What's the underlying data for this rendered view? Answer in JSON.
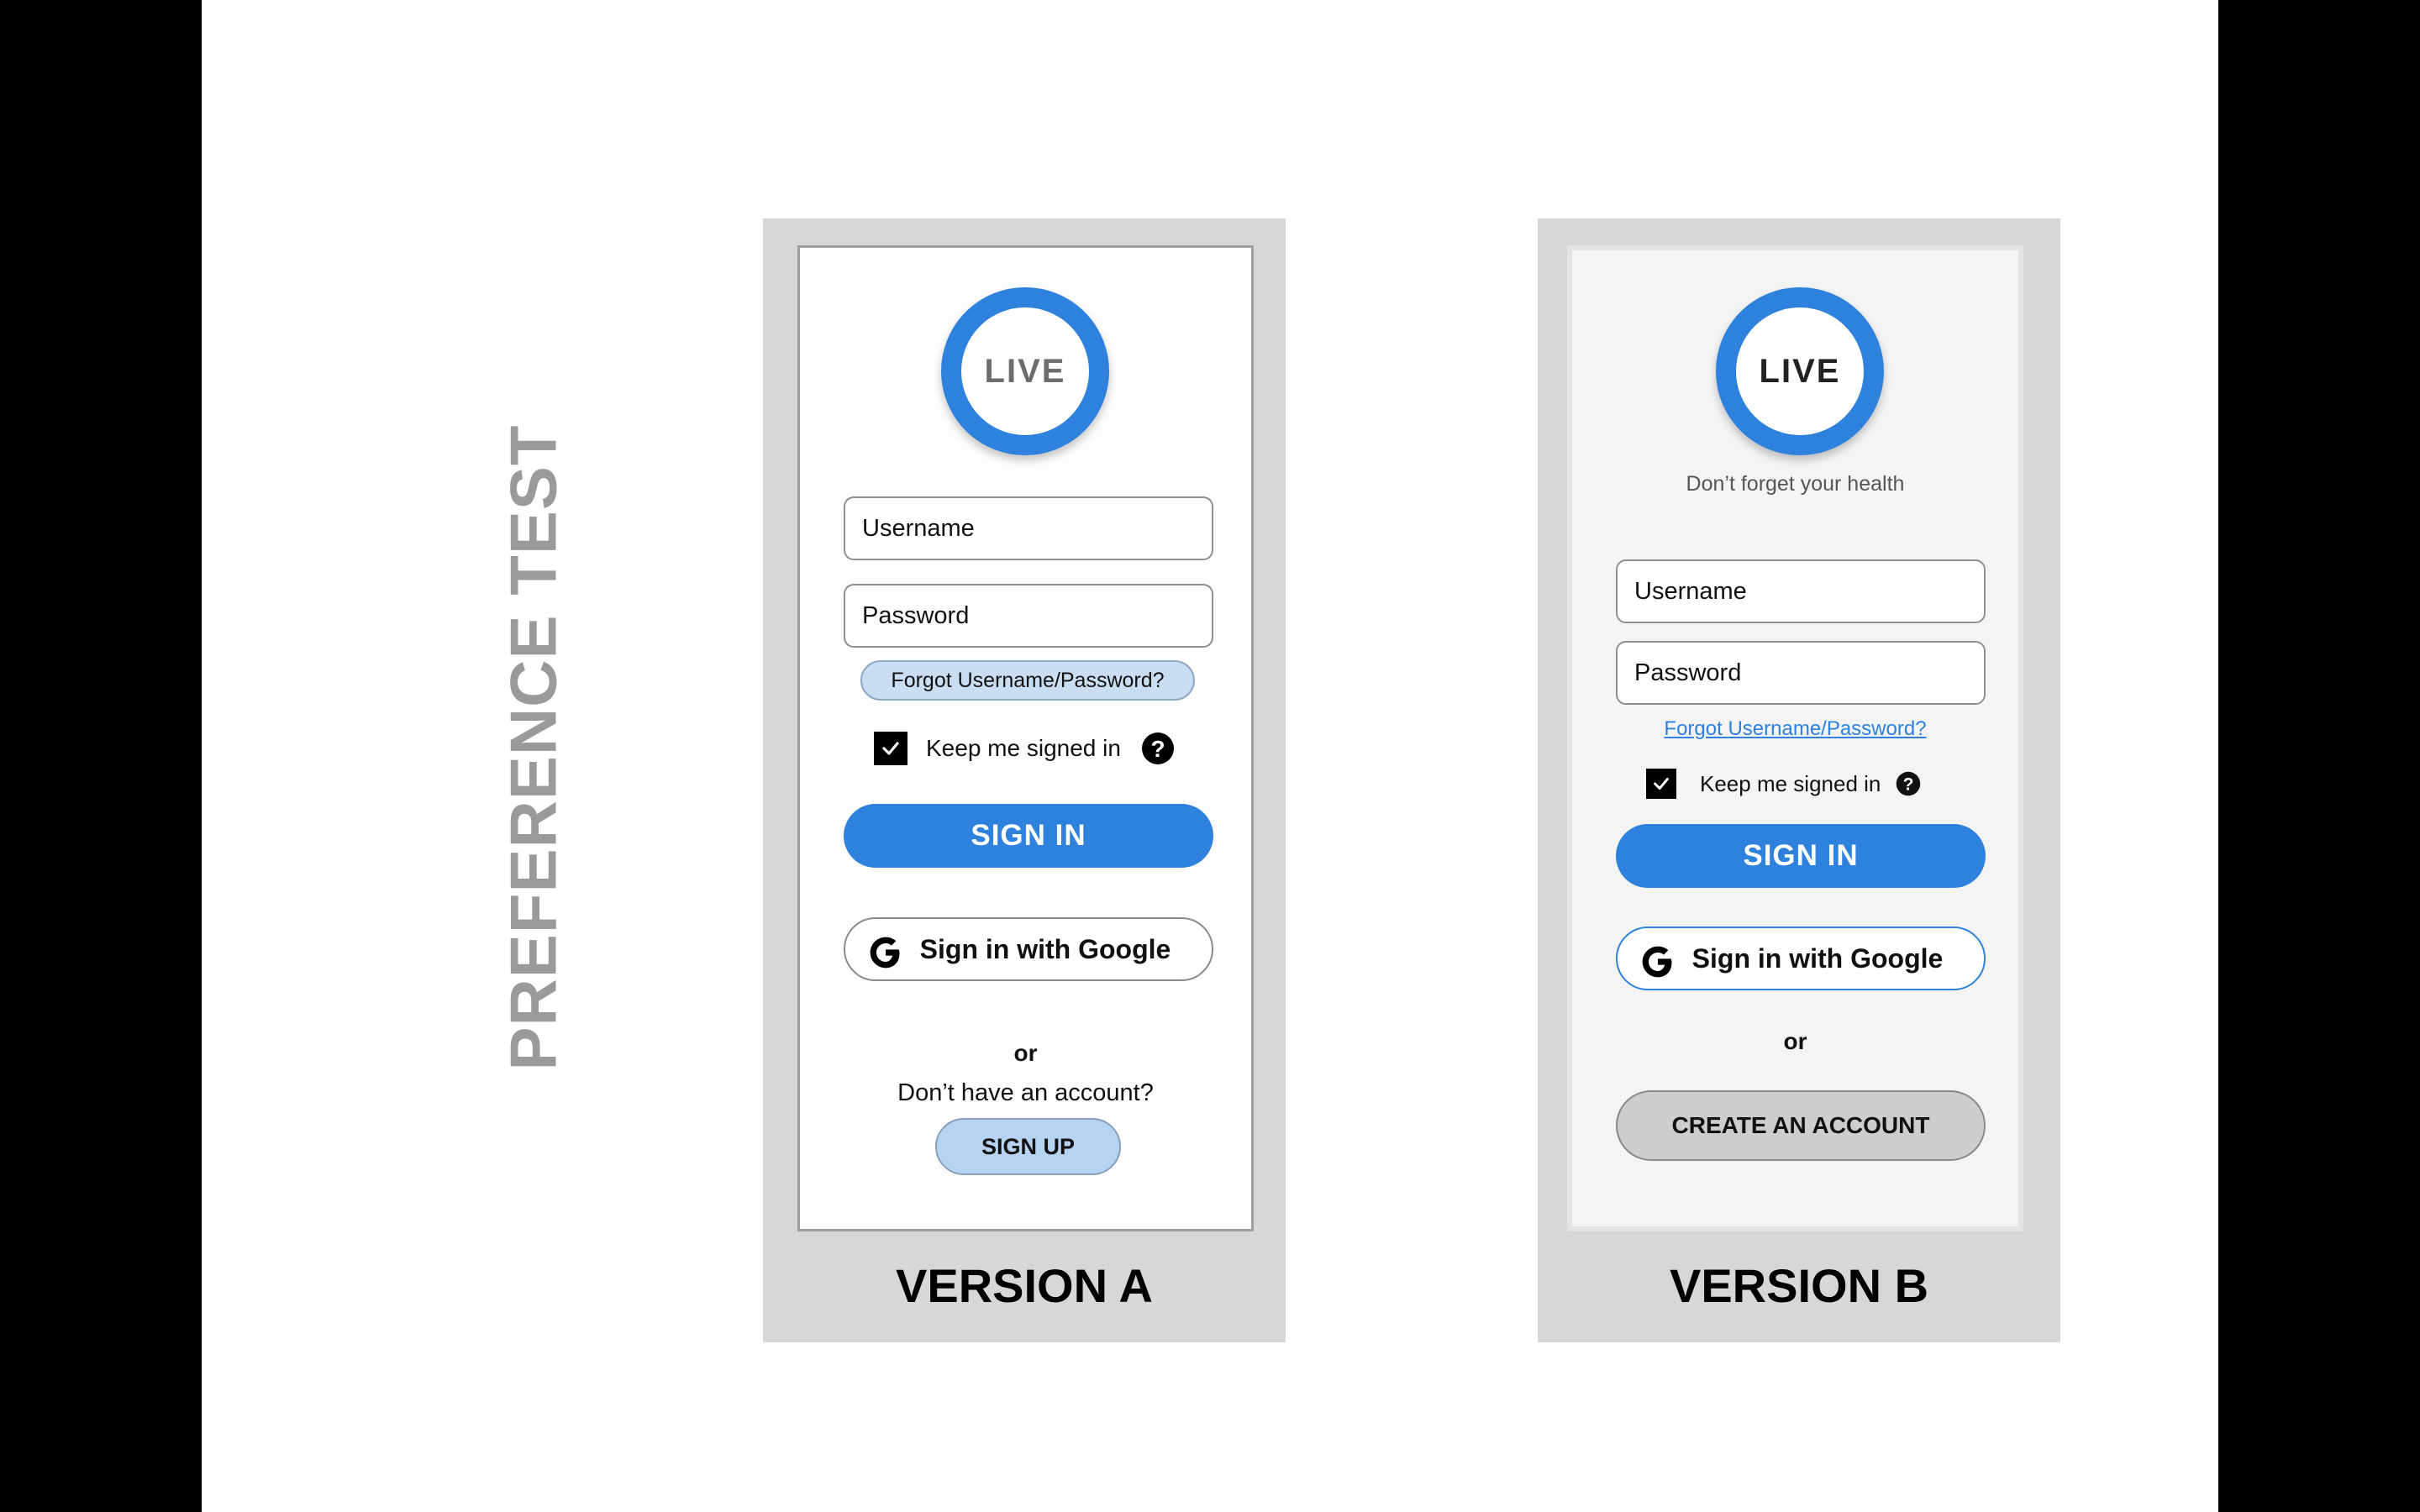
{
  "slide": {
    "side_title": "PREFERENCE TEST"
  },
  "colors": {
    "accent_blue": "#2e81dc",
    "light_blue": "#b6d3f1",
    "panel_gray": "#d7d7d7",
    "create_account_gray": "#cdcdcd"
  },
  "version_a": {
    "label": "VERSION A",
    "logo_text": "LIVE",
    "username_placeholder": "Username",
    "password_placeholder": "Password",
    "forgot_link": "Forgot Username/Password?",
    "keep_signed_in": "Keep me signed in",
    "keep_signed_in_checked": true,
    "help_icon": "question-circle-icon",
    "sign_in": "SIGN IN",
    "google_button": "Sign in with Google",
    "or_text": "or",
    "no_account_text": "Don’t have an account?",
    "sign_up": "SIGN UP"
  },
  "version_b": {
    "label": "VERSION B",
    "logo_text": "LIVE",
    "tagline": "Don’t forget your health",
    "username_placeholder": "Username",
    "password_placeholder": "Password",
    "forgot_link": "Forgot Username/Password?",
    "keep_signed_in": "Keep me signed in",
    "keep_signed_in_checked": true,
    "help_icon": "question-circle-icon",
    "sign_in": "SIGN IN",
    "google_button": "Sign in with Google",
    "or_text": "or",
    "create_account": "CREATE AN ACCOUNT"
  }
}
